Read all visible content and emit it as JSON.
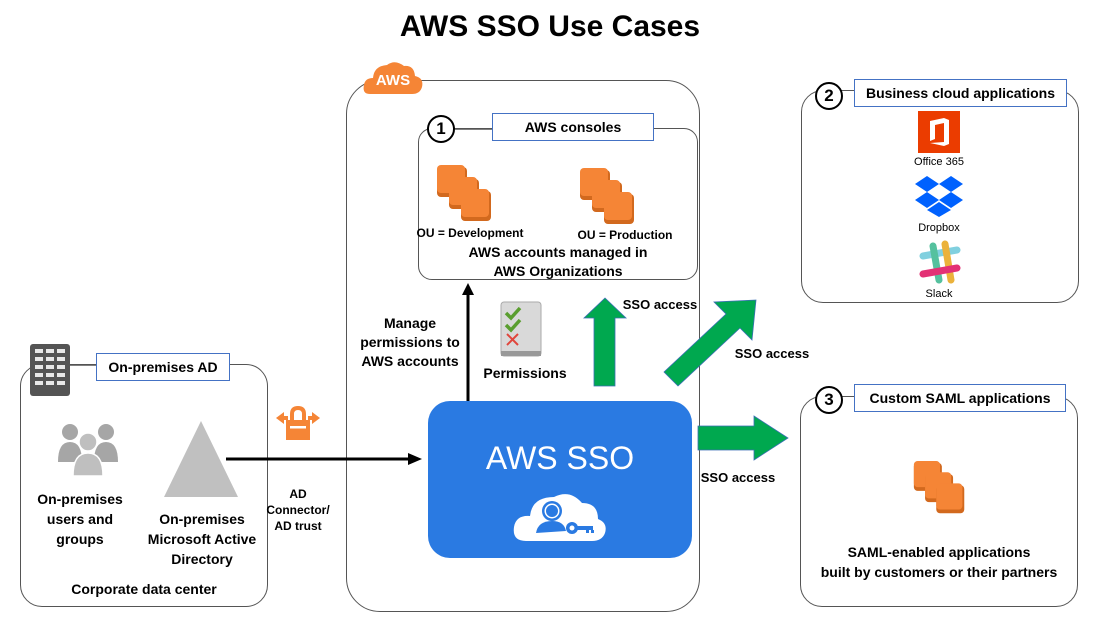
{
  "title": "AWS SSO Use Cases",
  "aws_cloud": {
    "badge": "AWS",
    "console_section": {
      "number": "1",
      "label": "AWS consoles",
      "ou_dev": "OU = Development",
      "ou_prod": "OU = Production",
      "caption_line1": "AWS accounts managed in",
      "caption_line2": "AWS Organizations"
    },
    "manage_label_line1": "Manage",
    "manage_label_line2": "permissions to",
    "manage_label_line3": "AWS accounts",
    "permissions_label": "Permissions",
    "sso_title": "AWS SSO"
  },
  "business_apps": {
    "number": "2",
    "label": "Business cloud applications",
    "apps": [
      "Office 365",
      "Dropbox",
      "Slack"
    ]
  },
  "custom_saml": {
    "number": "3",
    "label": "Custom SAML applications",
    "caption_line1": "SAML-enabled applications",
    "caption_line2": "built by customers or their partners"
  },
  "on_prem": {
    "label": "On-premises AD",
    "users_line1": "On-premises",
    "users_line2": "users and",
    "users_line3": "groups",
    "ad_line1": "On-premises",
    "ad_line2": "Microsoft Active",
    "ad_line3": "Directory",
    "footer": "Corporate data center"
  },
  "connector": {
    "line1": "AD",
    "line2": "Connector/",
    "line3": "AD trust"
  },
  "arrows": {
    "sso_access_up": "SSO access",
    "sso_access_diag": "SSO access",
    "sso_access_right": "SSO access"
  },
  "colors": {
    "aws_orange": "#f58536",
    "sso_blue": "#2a7ae2",
    "arrow_green": "#00a84f",
    "label_border": "#4472c4"
  }
}
